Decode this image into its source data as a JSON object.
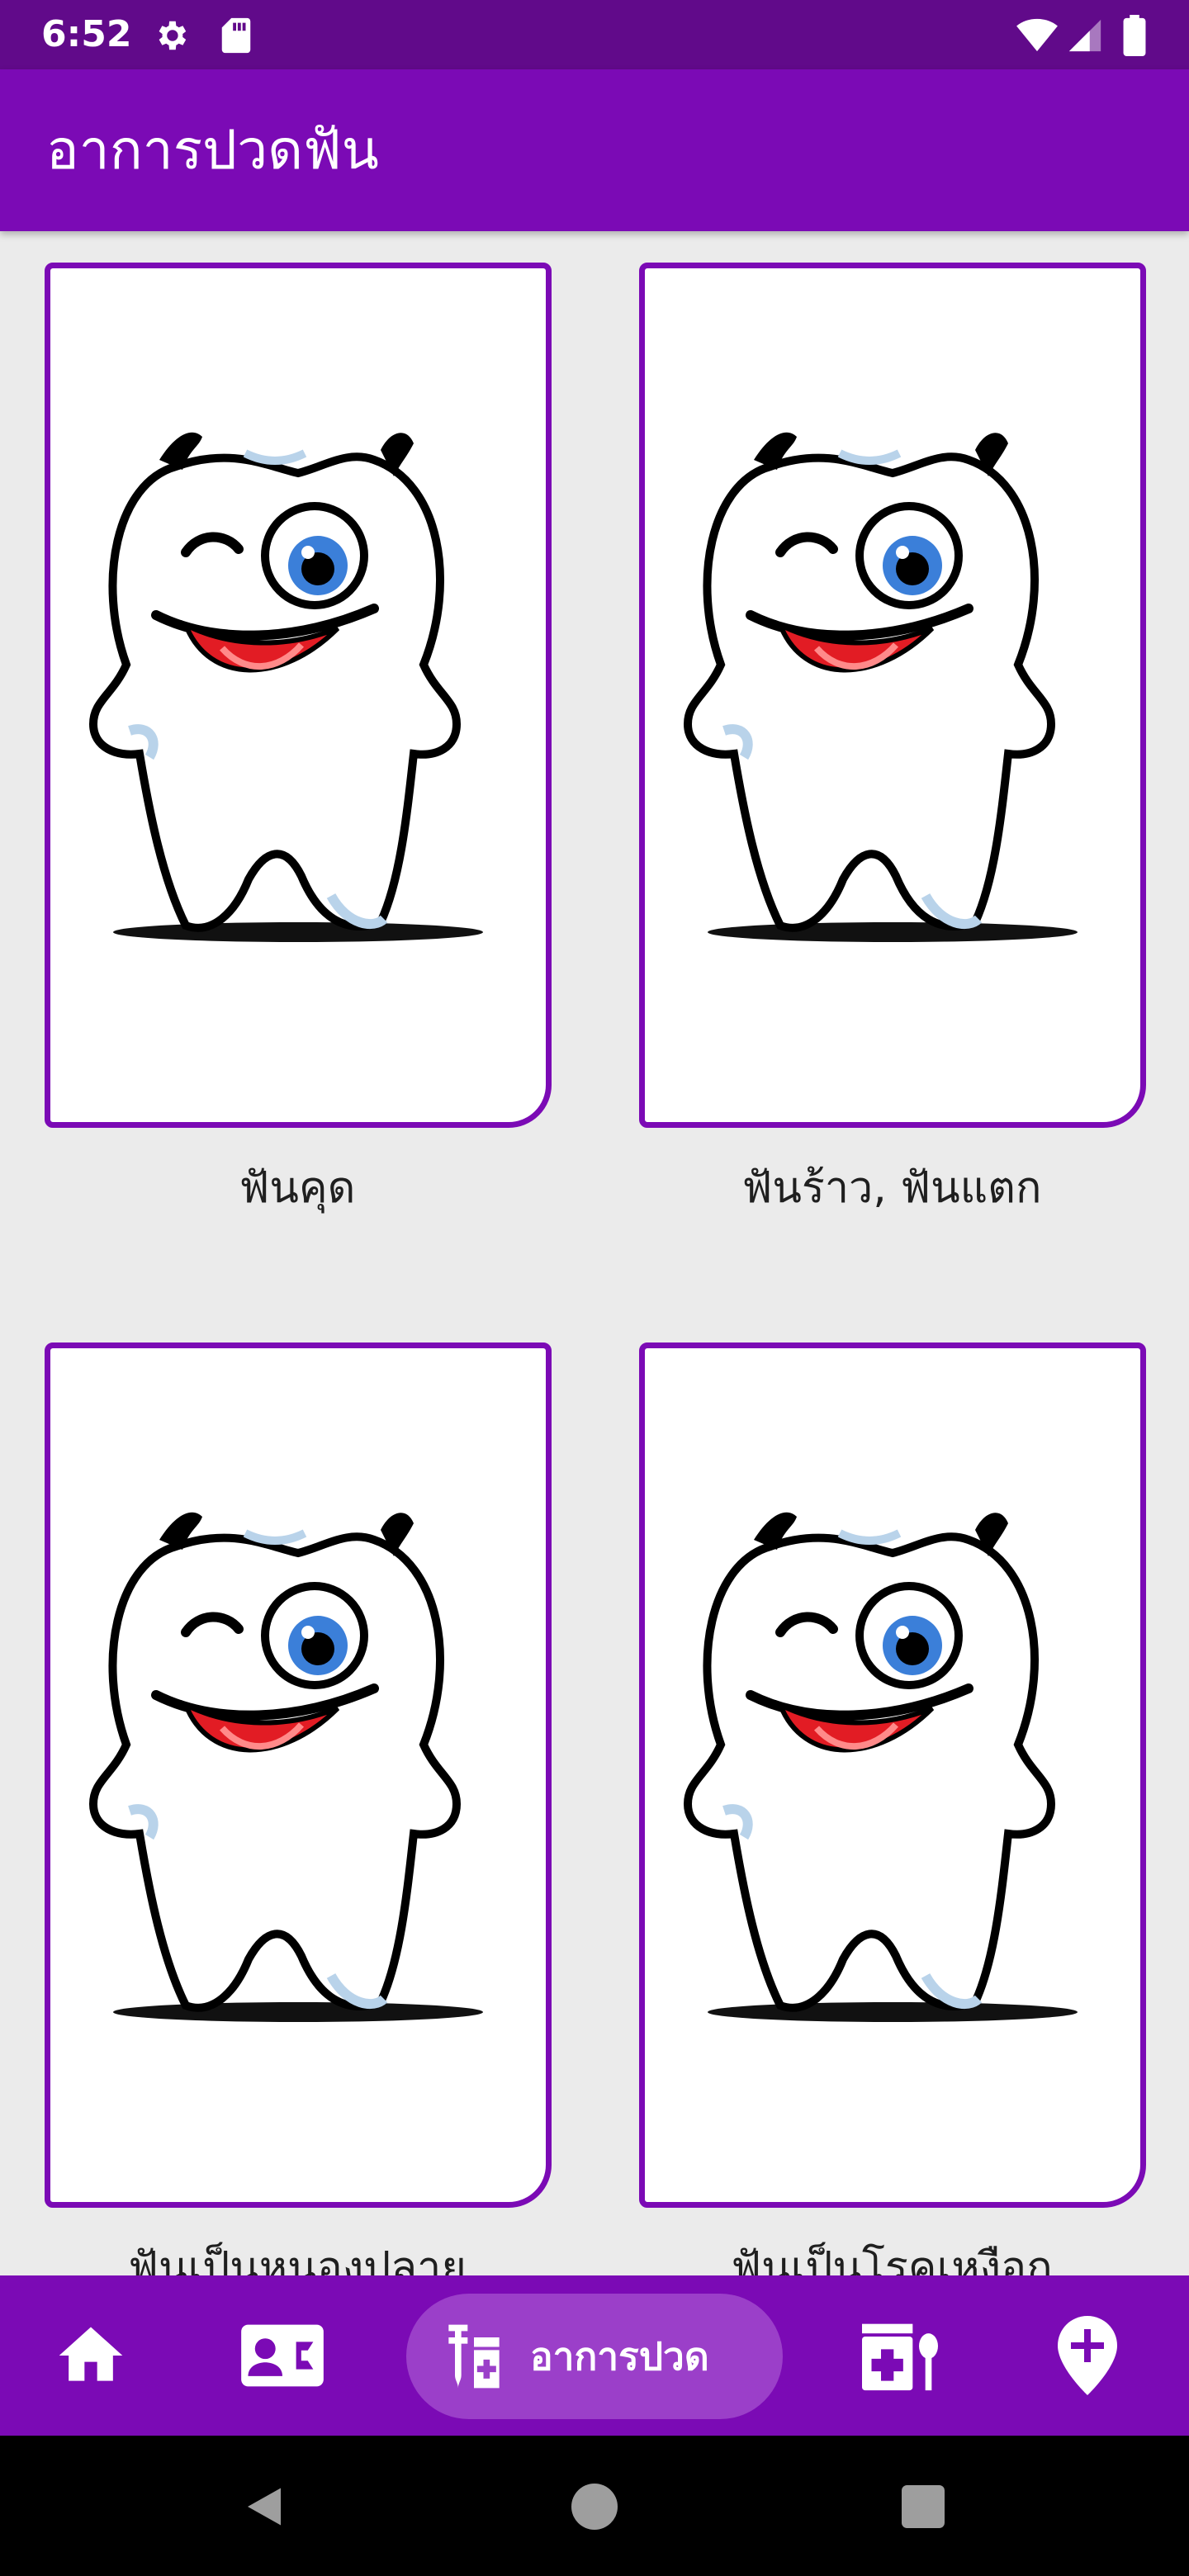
{
  "status_bar": {
    "time": "6:52",
    "icons": [
      "gear-icon",
      "sd-card-icon",
      "wifi-icon",
      "signal-icon",
      "battery-icon"
    ]
  },
  "app_bar": {
    "title": "อาการปวดฟัน"
  },
  "cards": [
    {
      "label": "ฟันคุด",
      "image": "tooth-mascot-image"
    },
    {
      "label": "ฟันร้าว, ฟันแตก",
      "image": "tooth-mascot-image"
    },
    {
      "label": "ฟันเป็นหนองปลาย",
      "image": "tooth-mascot-image"
    },
    {
      "label": "ฟันเป็นโรคเหงือก",
      "image": "tooth-mascot-image"
    }
  ],
  "bottom_nav": {
    "items": [
      {
        "icon": "home-icon"
      },
      {
        "icon": "contact-card-icon"
      },
      {
        "icon": "medicine-icon",
        "label": "อาการปวด",
        "selected": true
      },
      {
        "icon": "medical-kit-icon"
      },
      {
        "icon": "location-pin-icon"
      }
    ]
  },
  "colors": {
    "primary": "#7b0ab5",
    "status_bar": "#610a8a",
    "selected_pill": "#9b3fc9",
    "background": "#ebebeb"
  }
}
